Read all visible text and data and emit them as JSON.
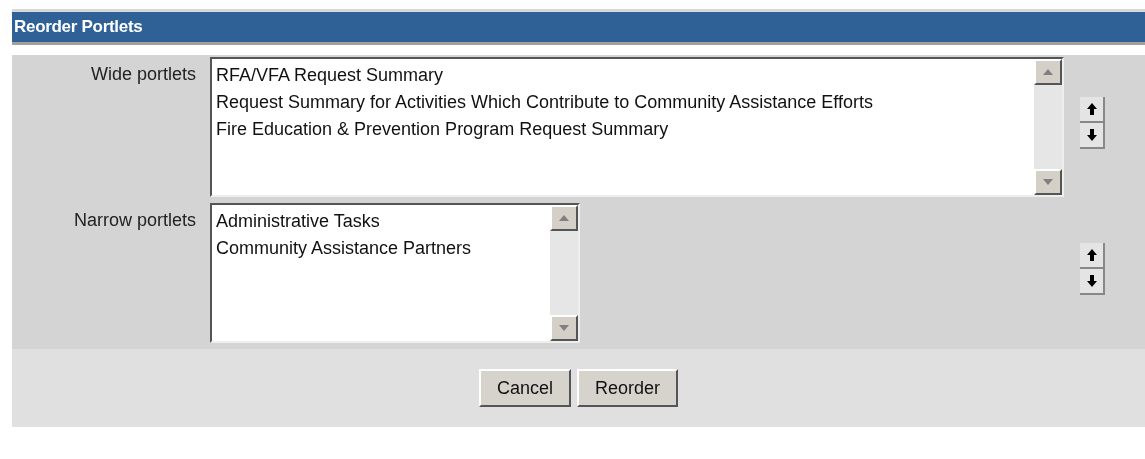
{
  "title": "Reorder Portlets",
  "lists": [
    {
      "label": "Wide portlets",
      "kind": "wide",
      "items": [
        {
          "text": "RFA/VFA Request Summary",
          "selected": false
        },
        {
          "text": "Request Summary for Activities Which Contribute to Community Assistance Efforts",
          "selected": false
        },
        {
          "text": "Fire Education & Prevention Program Request Summary",
          "selected": false
        }
      ]
    },
    {
      "label": "Narrow portlets",
      "kind": "narrow",
      "items": [
        {
          "text": "Administrative Tasks",
          "selected": false
        },
        {
          "text": "Community Assistance Partners",
          "selected": false
        }
      ]
    }
  ],
  "buttons": [
    "Cancel",
    "Reorder"
  ]
}
